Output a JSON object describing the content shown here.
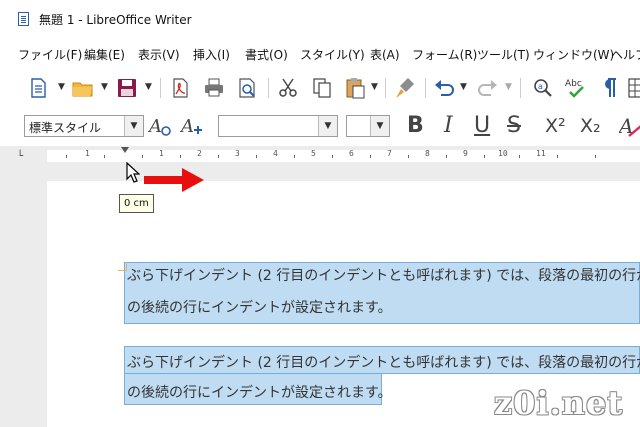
{
  "window": {
    "title": "無題 1 - LibreOffice Writer"
  },
  "menu": [
    "ファイル(F)",
    "編集(E)",
    "表示(V)",
    "挿入(I)",
    "書式(O)",
    "スタイル(Y)",
    "表(A)",
    "フォーム(R)",
    "ツール(T)",
    "ウィンドウ(W)",
    "ヘルプ"
  ],
  "formatting": {
    "paragraph_style": "標準スタイル",
    "font_name": "",
    "font_size": "",
    "bold": "B",
    "italic": "I",
    "underline": "U",
    "strikethrough": "S",
    "superscript": "X²",
    "subscript": "X₂"
  },
  "ruler": {
    "numbers": [
      "1",
      "1",
      "2",
      "3",
      "4",
      "5",
      "6",
      "7",
      "8",
      "9",
      "10",
      "11"
    ]
  },
  "tooltip": "0 cm",
  "document": {
    "paragraph1": [
      "ぶら下げインデント (2 行目のインデントとも呼ばれます) では、段落の最初の行が余",
      "の後続の行にインデントが設定されます。"
    ],
    "paragraph2": [
      "ぶら下げインデント (2 行目のインデントとも呼ばれます) では、段落の最初の行が余",
      "の後続の行にインデントが設定されます。"
    ]
  },
  "watermark": "z0i.net",
  "colors": {
    "accent_blue": "#2a5ea8",
    "arrow_red": "#e8100f",
    "selection": "#bfdcf3",
    "ui_gray": "#ececec"
  }
}
